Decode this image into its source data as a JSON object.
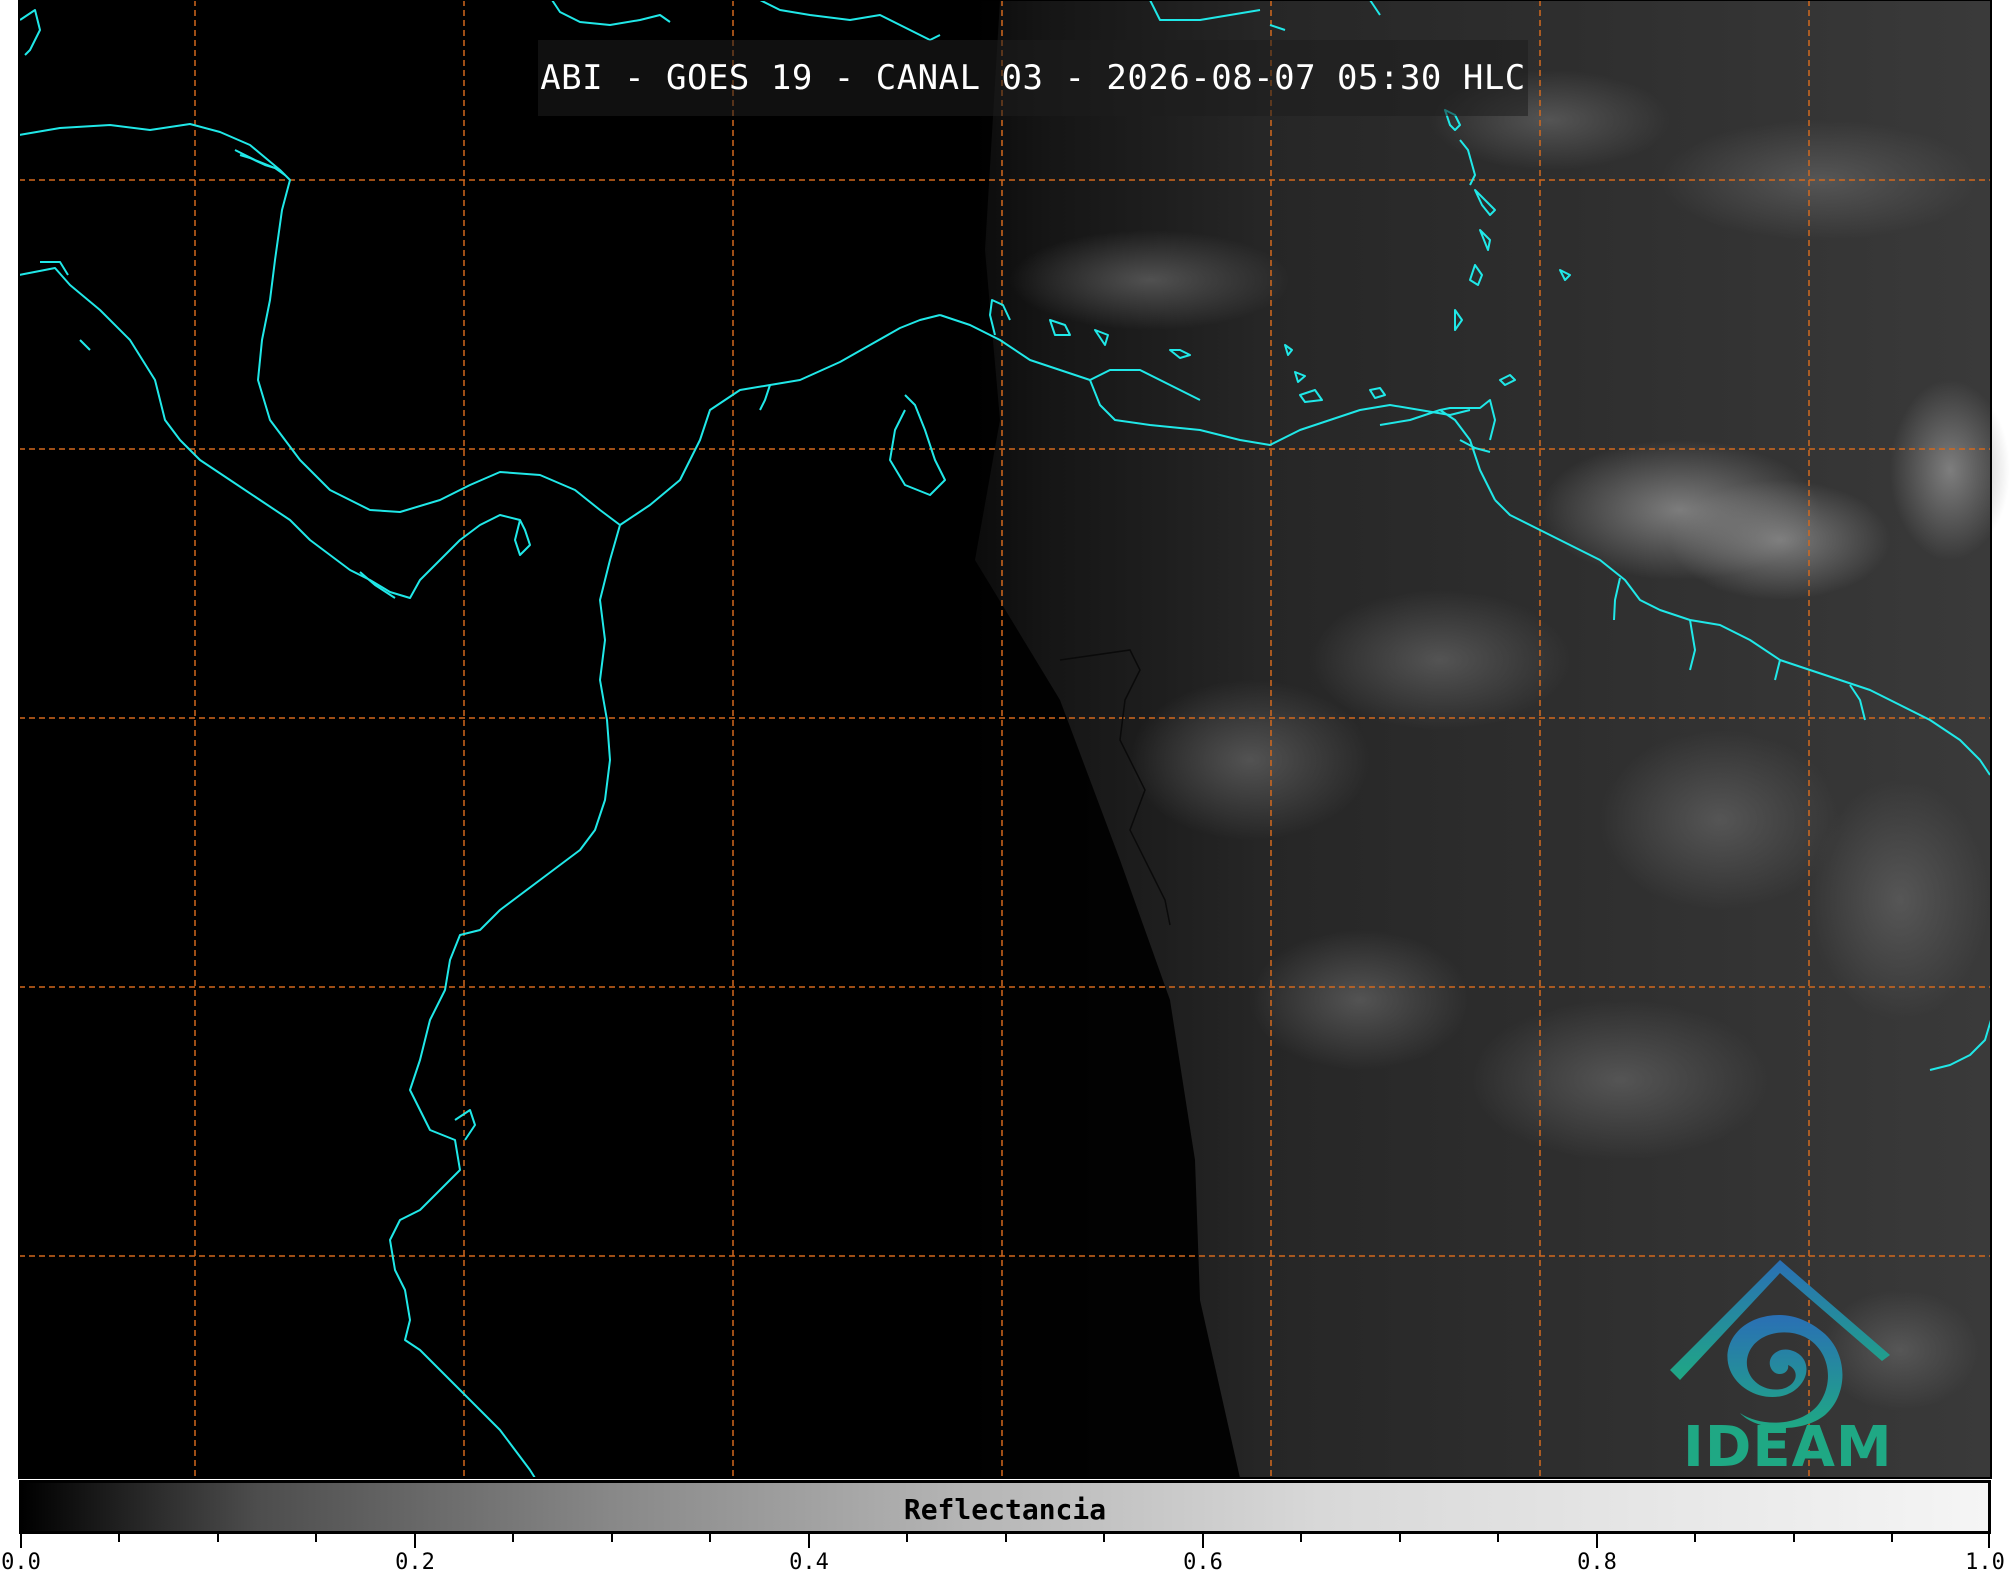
{
  "title": "ABI - GOES 19 - CANAL 03 - 2026-08-07 05:30 HLC",
  "colorbar": {
    "label": "Reflectancia",
    "ticks": [
      "0.0",
      "0.2",
      "0.4",
      "0.6",
      "0.8",
      "1.0"
    ],
    "colors": [
      "#000000",
      "#ffffff"
    ]
  },
  "logo": {
    "text": "IDEAM",
    "colors": [
      "#2a6fb5",
      "#1fa884"
    ]
  },
  "map": {
    "coastline_color": "#20e8e8",
    "grid_color": "#d2691e",
    "background_color": "#000000"
  }
}
